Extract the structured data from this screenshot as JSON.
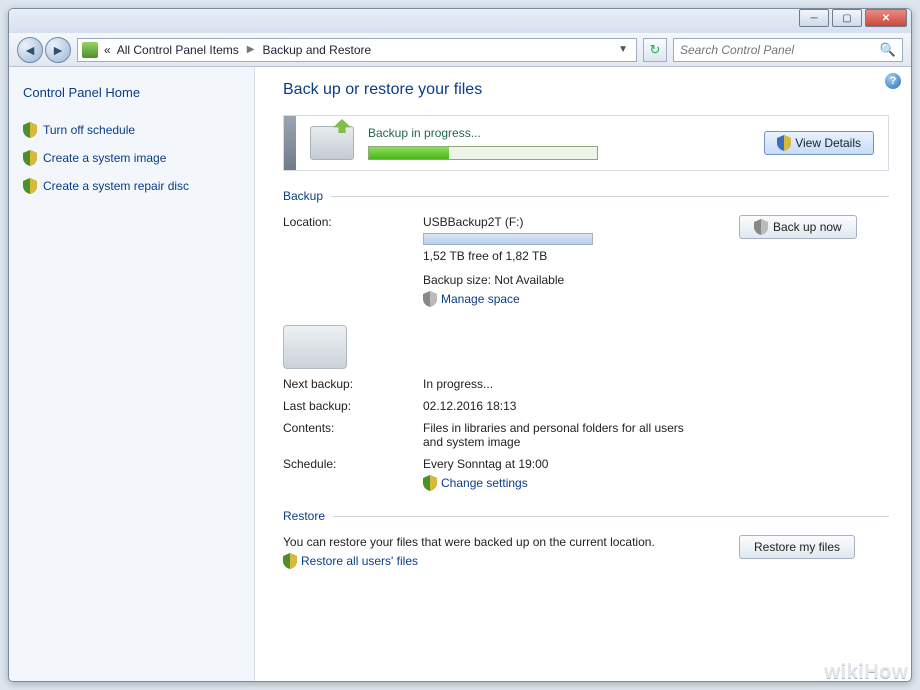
{
  "breadcrumb": {
    "item1": "All Control Panel Items",
    "item2": "Backup and Restore"
  },
  "search": {
    "placeholder": "Search Control Panel"
  },
  "sidebar": {
    "home": "Control Panel Home",
    "links": [
      {
        "label": "Turn off schedule"
      },
      {
        "label": "Create a system image"
      },
      {
        "label": "Create a system repair disc"
      }
    ]
  },
  "main": {
    "heading": "Back up or restore your files",
    "progress": {
      "status": "Backup in progress...",
      "view_details": "View Details"
    },
    "backup": {
      "section": "Backup",
      "location_label": "Location:",
      "location": "USBBackup2T (F:)",
      "free": "1,52 TB free of 1,82 TB",
      "size": "Backup size: Not Available",
      "manage": "Manage space",
      "backup_now": "Back up now",
      "next_label": "Next backup:",
      "next": "In progress...",
      "last_label": "Last backup:",
      "last": "02.12.2016 18:13",
      "contents_label": "Contents:",
      "contents": "Files in libraries and personal folders for all users and system image",
      "schedule_label": "Schedule:",
      "schedule": "Every Sonntag at 19:00",
      "change": "Change settings"
    },
    "restore": {
      "section": "Restore",
      "desc": "You can restore your files that were backed up on the current location.",
      "restore_all": "Restore all users' files",
      "restore_my": "Restore my files"
    }
  },
  "watermark": "wikiHow"
}
